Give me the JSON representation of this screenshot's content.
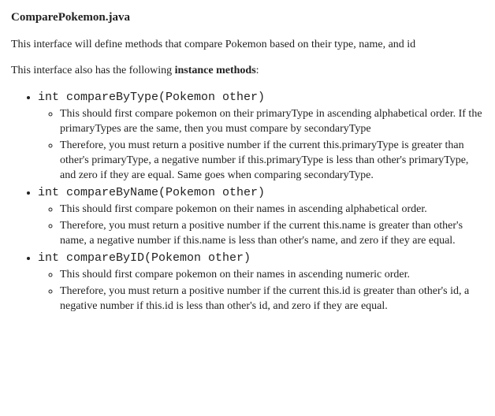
{
  "title": "ComparePokemon.java",
  "intro": "This interface will define methods that compare Pokemon based on their type, name, and id",
  "methods_intro_pre": "This interface also has the following ",
  "methods_intro_bold": "instance methods",
  "methods_intro_post": ":",
  "methods": [
    {
      "signature": "int compareByType(Pokemon other)",
      "details": [
        "This should first compare pokemon on their primaryType in ascending alphabetical order. If the primaryTypes are the same, then you must compare by secondaryType",
        "Therefore, you must return a positive number if the current this.primaryType is greater than other's primaryType, a negative number if this.primaryType is less than other's primaryType, and zero if they are equal. Same goes when comparing secondaryType."
      ]
    },
    {
      "signature": "int compareByName(Pokemon other)",
      "details": [
        "This should first compare pokemon on their names in ascending alphabetical order.",
        "Therefore, you must return a positive number if the current this.name is greater than other's name, a negative number if this.name is less than other's name, and zero if they are equal."
      ]
    },
    {
      "signature": "int compareByID(Pokemon other)",
      "details": [
        "This should first compare pokemon on their names in ascending numeric order.",
        "Therefore, you must return a positive number if the current this.id is greater than other's id, a negative number if this.id is less than other's id, and zero if they are equal."
      ]
    }
  ]
}
